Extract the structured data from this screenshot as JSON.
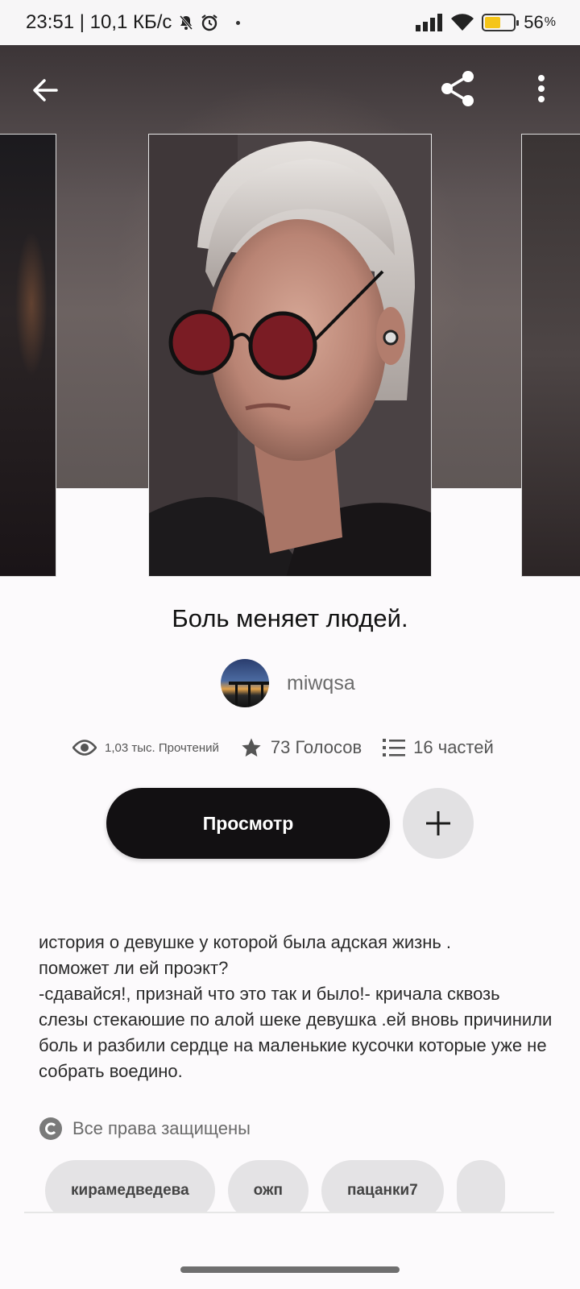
{
  "status_bar": {
    "time_speed": "23:51 | 10,1 КБ/с",
    "battery_percent": "56",
    "battery_level": 0.56,
    "icons": [
      "mute-icon",
      "alarm-icon",
      "signal-icon",
      "wifi-icon",
      "battery-icon"
    ]
  },
  "story": {
    "title": "Боль меняет людей.",
    "author": "miwqsa",
    "reads": "1,03 тыс. Прочтений",
    "votes": "73 Голосов",
    "parts": "16 частей",
    "read_button": "Просмотр",
    "description": "история о девушке у которой была адская жизнь .\nпоможет ли ей проэкт?\n-сдавайся!, признай что это так и было!- кричала сквозь слезы стекаюшие по алой шеке девушка .ей вновь причинили боль и разбили сердце на маленькие кусочки которые уже не собрать воедино.",
    "copyright": "Все права защищены",
    "tags": [
      "кирамедведева",
      "ожп",
      "пацанки7"
    ]
  },
  "colors": {
    "primary_button": "#121012",
    "secondary_button": "#e2e1e3",
    "tag_bg": "#e4e3e5",
    "battery_fill": "#f5c518"
  }
}
